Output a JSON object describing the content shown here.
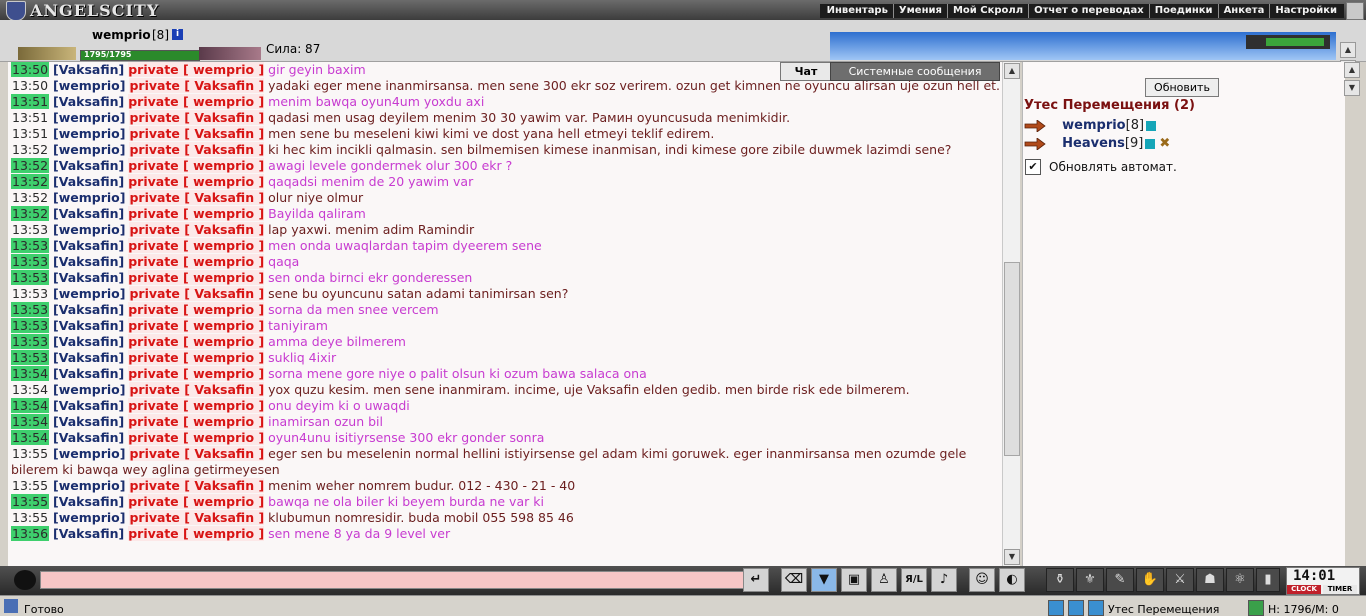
{
  "app": {
    "logo": "ANGELSCITY"
  },
  "menu": [
    "Инвентарь",
    "Умения",
    "Мой Скролл",
    "Отчет о переводах",
    "Поединки",
    "Анкета",
    "Настройки"
  ],
  "user": {
    "name": "wemprio",
    "level": "[8]",
    "hp": "1795/1795",
    "strength": "Сила: 87",
    "info_icon": "i"
  },
  "tabs": {
    "chat": "Чат",
    "system": "Системные сообщения"
  },
  "chat": [
    {
      "time": "13:50",
      "hl": true,
      "from": "[Vaksafin]",
      "to": "private [ wemprio ]",
      "text": "gir geyin baxim",
      "self": false
    },
    {
      "time": "13:50",
      "hl": false,
      "from": "[wemprio]",
      "to": "private [ Vaksafin ]",
      "text": "yadaki eger mene inanmirsansa. men sene 300 ekr soz verirem. ozun get kimnen ne oyuncu alirsan uje ozun hell et.",
      "self": true
    },
    {
      "time": "13:51",
      "hl": true,
      "from": "[Vaksafin]",
      "to": "private [ wemprio ]",
      "text": "menim bawqa oyun4um yoxdu axi",
      "self": false
    },
    {
      "time": "13:51",
      "hl": false,
      "from": "[wemprio]",
      "to": "private [ Vaksafin ]",
      "text": "qadasi men usag deyilem menim 30 30 yawim var. Рамин оyuncusuda menimkidir.",
      "self": true
    },
    {
      "time": "13:51",
      "hl": false,
      "from": "[wemprio]",
      "to": "private [ Vaksafin ]",
      "text": "men sene bu meseleni kiwi kimi ve dost yana hell etmeyi teklif edirem.",
      "self": true
    },
    {
      "time": "13:52",
      "hl": false,
      "from": "[wemprio]",
      "to": "private [ Vaksafin ]",
      "text": "ki hec kim incikli qalmasin. sen bilmemisen kimese inanmisan, indi kimese gore zibile duwmek lazimdi sene?",
      "self": true
    },
    {
      "time": "13:52",
      "hl": true,
      "from": "[Vaksafin]",
      "to": "private [ wemprio ]",
      "text": "awagi levele gondermek olur 300 ekr ?",
      "self": false
    },
    {
      "time": "13:52",
      "hl": true,
      "from": "[Vaksafin]",
      "to": "private [ wemprio ]",
      "text": "qaqadsi menim de 20 yawim var",
      "self": false
    },
    {
      "time": "13:52",
      "hl": false,
      "from": "[wemprio]",
      "to": "private [ Vaksafin ]",
      "text": "olur niye olmur",
      "self": true
    },
    {
      "time": "13:52",
      "hl": true,
      "from": "[Vaksafin]",
      "to": "private [ wemprio ]",
      "text": "Bayilda qaliram",
      "self": false
    },
    {
      "time": "13:53",
      "hl": false,
      "from": "[wemprio]",
      "to": "private [ Vaksafin ]",
      "text": "lap yaxwi. menim adim Ramindir",
      "self": true
    },
    {
      "time": "13:53",
      "hl": true,
      "from": "[Vaksafin]",
      "to": "private [ wemprio ]",
      "text": "men onda uwaqlardan tapim dyeerem sene",
      "self": false
    },
    {
      "time": "13:53",
      "hl": true,
      "from": "[Vaksafin]",
      "to": "private [ wemprio ]",
      "text": "qaqa",
      "self": false
    },
    {
      "time": "13:53",
      "hl": true,
      "from": "[Vaksafin]",
      "to": "private [ wemprio ]",
      "text": "sen onda birnci ekr gonderessen",
      "self": false
    },
    {
      "time": "13:53",
      "hl": false,
      "from": "[wemprio]",
      "to": "private [ Vaksafin ]",
      "text": "sene bu oyuncunu satan adami tanimirsan sen?",
      "self": true
    },
    {
      "time": "13:53",
      "hl": true,
      "from": "[Vaksafin]",
      "to": "private [ wemprio ]",
      "text": "sorna da men snee vercem",
      "self": false
    },
    {
      "time": "13:53",
      "hl": true,
      "from": "[Vaksafin]",
      "to": "private [ wemprio ]",
      "text": "taniyiram",
      "self": false
    },
    {
      "time": "13:53",
      "hl": true,
      "from": "[Vaksafin]",
      "to": "private [ wemprio ]",
      "text": "amma deye bilmerem",
      "self": false
    },
    {
      "time": "13:53",
      "hl": true,
      "from": "[Vaksafin]",
      "to": "private [ wemprio ]",
      "text": "sukliq 4ixir",
      "self": false
    },
    {
      "time": "13:54",
      "hl": true,
      "from": "[Vaksafin]",
      "to": "private [ wemprio ]",
      "text": "sorna mene gore niye o palit olsun ki ozum bawa salaca ona",
      "self": false
    },
    {
      "time": "13:54",
      "hl": false,
      "from": "[wemprio]",
      "to": "private [ Vaksafin ]",
      "text": "yox quzu kesim. men sene inanmiram. incime, uje Vaksafin elden gedib. men birde risk ede bilmerem.",
      "self": true
    },
    {
      "time": "13:54",
      "hl": true,
      "from": "[Vaksafin]",
      "to": "private [ wemprio ]",
      "text": "onu deyim ki o uwaqdi",
      "self": false
    },
    {
      "time": "13:54",
      "hl": true,
      "from": "[Vaksafin]",
      "to": "private [ wemprio ]",
      "text": "inamirsan ozun bil",
      "self": false
    },
    {
      "time": "13:54",
      "hl": true,
      "from": "[Vaksafin]",
      "to": "private [ wemprio ]",
      "text": "oyun4unu isitiyrsense 300 ekr gonder sonra",
      "self": false
    },
    {
      "time": "13:55",
      "hl": false,
      "from": "[wemprio]",
      "to": "private [ Vaksafin ]",
      "text": "eger sen bu meselenin normal hellini istiyirsense gel adam kimi goruwek. eger inanmirsansa men ozumde gele bilerem ki bawqa wey aglina getirmeyesen",
      "self": true
    },
    {
      "time": "13:55",
      "hl": false,
      "from": "[wemprio]",
      "to": "private [ Vaksafin ]",
      "text": "menim weher nomrem budur. 012 - 430 - 21 - 40",
      "self": true
    },
    {
      "time": "13:55",
      "hl": true,
      "from": "[Vaksafin]",
      "to": "private [ wemprio ]",
      "text": "bawqa ne ola biler ki beyem burda ne var ki",
      "self": false
    },
    {
      "time": "13:55",
      "hl": false,
      "from": "[wemprio]",
      "to": "private [ Vaksafin ]",
      "text": "klubumun nomresidir. buda mobil 055 598 85 46",
      "self": true
    },
    {
      "time": "13:56",
      "hl": true,
      "from": "[Vaksafin]",
      "to": "private [ wemprio ]",
      "text": "sen mene 8 ya da 9 level ver",
      "self": false
    }
  ],
  "side": {
    "refresh": "Обновить",
    "location_title": "Утес Перемещения (2)",
    "players": [
      {
        "name": "wemprio",
        "level": "[8]"
      },
      {
        "name": "Heavens",
        "level": "[9]"
      }
    ],
    "attack_icon": "✖",
    "auto_refresh": "Обновлять автомат.",
    "checkbox_mark": "✔"
  },
  "toolbar": {
    "enter": "↵",
    "clear": "⌫",
    "filter": "▼",
    "save": "▣",
    "person": "♙",
    "translit": "Я/L",
    "sound": "♪",
    "smile": "☺",
    "face": "◐",
    "right_icons": [
      "⚱",
      "⚜",
      "✎",
      "✋",
      "⚔",
      "☗",
      "⚛",
      "▮"
    ]
  },
  "clock": {
    "time": "14:01",
    "clock_label": "CLOCK",
    "timer_label": "TIMER"
  },
  "statusbar": {
    "status": "Готово",
    "location": "Утес Перемещения",
    "hp": "H: 1796/M: 0"
  }
}
